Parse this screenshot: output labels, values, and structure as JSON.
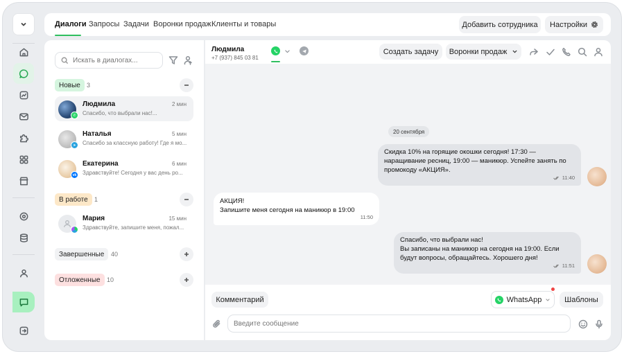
{
  "header": {
    "tabs": [
      {
        "label": "Диалоги",
        "active": true
      },
      {
        "label": "Запросы"
      },
      {
        "label": "Задачи"
      },
      {
        "label": "Воронки продаж"
      },
      {
        "label": "Клиенты и товары"
      }
    ],
    "add_employee_label": "Добавить сотрудника",
    "settings_label": "Настройки"
  },
  "sidebar": {
    "icons": [
      "chevron-down-icon",
      "home-icon",
      "chat-bubble-icon",
      "chart-icon",
      "mail-icon",
      "puzzle-icon",
      "apps-grid-icon",
      "store-icon",
      "settings-icon",
      "database-icon",
      "user-icon",
      "support-chat-icon",
      "logout-icon"
    ]
  },
  "dialogs": {
    "search_placeholder": "Искать в диалогах...",
    "groups": {
      "new": {
        "label": "Новые",
        "count": "3",
        "color": "#d5f5df",
        "items": [
          {
            "name": "Людмила",
            "time": "2 мин",
            "preview": "Спасибо, что выбрали нас!...",
            "channel": "whatsapp"
          },
          {
            "name": "Наталья",
            "time": "5 мин",
            "preview": "Спасибо за классную работу! Где я мо...",
            "channel": "telegram"
          },
          {
            "name": "Екатерина",
            "time": "6 мин",
            "preview": "Здравствуйте! Сегодня у вас день ро...",
            "channel": "vk"
          }
        ]
      },
      "in_work": {
        "label": "В работе",
        "count": "1",
        "color": "#fde8c8",
        "items": [
          {
            "name": "Мария",
            "time": "15 мин",
            "preview": "Здравствуйте, запишите меня, пожал...",
            "channel": "multi"
          }
        ]
      },
      "done": {
        "label": "Завершенные",
        "count": "40",
        "color": "#f1f2f4"
      },
      "postponed": {
        "label": "Отложенные",
        "count": "10",
        "color": "#fde0e0"
      }
    }
  },
  "chat": {
    "contact_name": "Людмила",
    "contact_phone": "+7 (937) 845 03 81",
    "create_task_label": "Создать задачу",
    "funnels_label": "Воронки продаж",
    "date_label": "20 сентября",
    "messages": [
      {
        "direction": "out",
        "text": "Скидка 10% на горящие окошки сегодня! 17:30 — наращивание ресниц, 19:00 — маникюр. Успейте занять по промокоду «АКЦИЯ».",
        "time": "11:40"
      },
      {
        "direction": "in",
        "line1": "АКЦИЯ!",
        "line2": "Запишите меня сегодня на маникюр в 19:00",
        "time": "11:50"
      },
      {
        "direction": "out",
        "line1": "Спасибо, что выбрали нас!",
        "line2": "Вы записаны на маникюр на сегодня на 19:00. Если будут вопросы, обращайтесь. Хорошего дня!",
        "time": "11:51"
      }
    ],
    "composer": {
      "comment_label": "Комментарий",
      "channel_label": "WhatsApp",
      "templates_label": "Шаблоны",
      "input_placeholder": "Введите сообщение"
    }
  },
  "colors": {
    "accent": "#2fbf5f",
    "whatsapp": "#25d366",
    "telegram": "#2aa3df",
    "vk": "#0077ff"
  }
}
